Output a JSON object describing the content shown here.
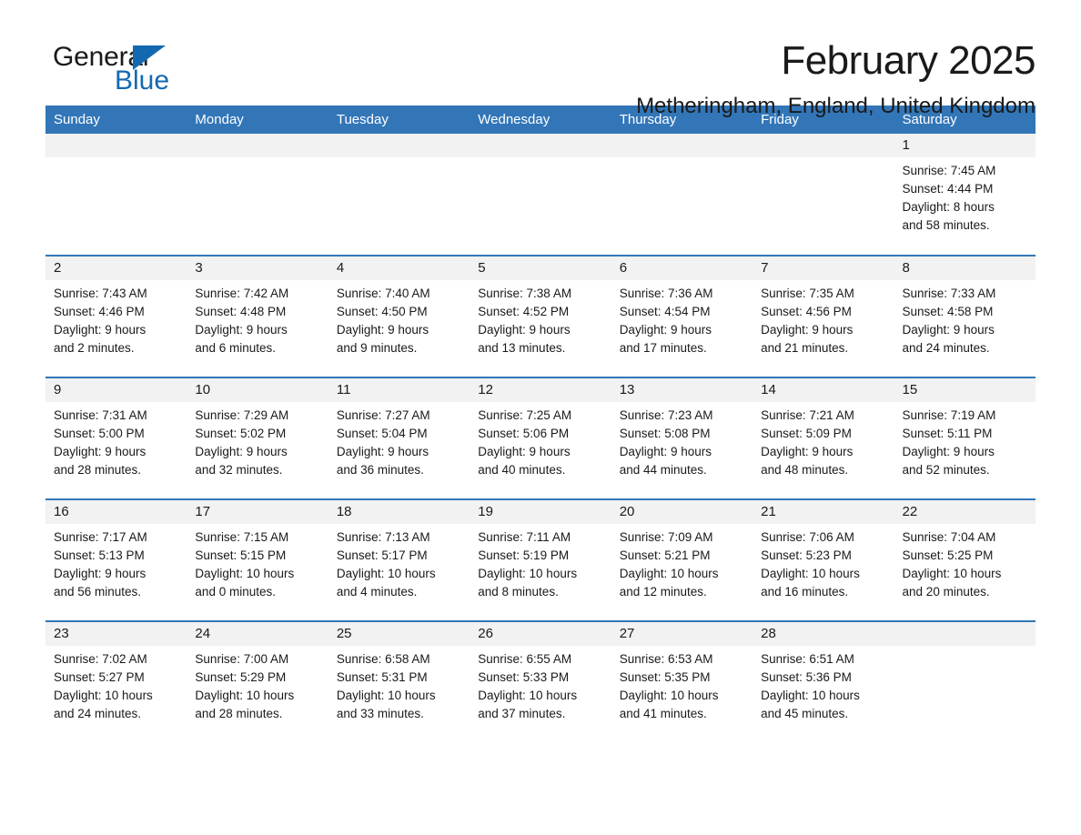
{
  "logo": {
    "word_one": "General",
    "word_two": "Blue",
    "triangle_color": "#1369b0",
    "icon": "triangle-icon"
  },
  "header": {
    "title": "February 2025",
    "subtitle": "Metheringham, England, United Kingdom"
  },
  "theme": {
    "header_blue": "#3276b8",
    "daynum_gray": "#f2f2f2",
    "text": "#1a1a1a",
    "logo_blue": "#1369b0"
  },
  "weekdays": [
    "Sunday",
    "Monday",
    "Tuesday",
    "Wednesday",
    "Thursday",
    "Friday",
    "Saturday"
  ],
  "labels": {
    "sunrise_prefix": "Sunrise:",
    "sunset_prefix": "Sunset:",
    "daylight_prefix": "Daylight:"
  },
  "weeks": [
    [
      {
        "day": "",
        "sunrise": "",
        "sunset": "",
        "daylight_l1": "",
        "daylight_l2": ""
      },
      {
        "day": "",
        "sunrise": "",
        "sunset": "",
        "daylight_l1": "",
        "daylight_l2": ""
      },
      {
        "day": "",
        "sunrise": "",
        "sunset": "",
        "daylight_l1": "",
        "daylight_l2": ""
      },
      {
        "day": "",
        "sunrise": "",
        "sunset": "",
        "daylight_l1": "",
        "daylight_l2": ""
      },
      {
        "day": "",
        "sunrise": "",
        "sunset": "",
        "daylight_l1": "",
        "daylight_l2": ""
      },
      {
        "day": "",
        "sunrise": "",
        "sunset": "",
        "daylight_l1": "",
        "daylight_l2": ""
      },
      {
        "day": "1",
        "sunrise": "Sunrise: 7:45 AM",
        "sunset": "Sunset: 4:44 PM",
        "daylight_l1": "Daylight: 8 hours",
        "daylight_l2": "and 58 minutes."
      }
    ],
    [
      {
        "day": "2",
        "sunrise": "Sunrise: 7:43 AM",
        "sunset": "Sunset: 4:46 PM",
        "daylight_l1": "Daylight: 9 hours",
        "daylight_l2": "and 2 minutes."
      },
      {
        "day": "3",
        "sunrise": "Sunrise: 7:42 AM",
        "sunset": "Sunset: 4:48 PM",
        "daylight_l1": "Daylight: 9 hours",
        "daylight_l2": "and 6 minutes."
      },
      {
        "day": "4",
        "sunrise": "Sunrise: 7:40 AM",
        "sunset": "Sunset: 4:50 PM",
        "daylight_l1": "Daylight: 9 hours",
        "daylight_l2": "and 9 minutes."
      },
      {
        "day": "5",
        "sunrise": "Sunrise: 7:38 AM",
        "sunset": "Sunset: 4:52 PM",
        "daylight_l1": "Daylight: 9 hours",
        "daylight_l2": "and 13 minutes."
      },
      {
        "day": "6",
        "sunrise": "Sunrise: 7:36 AM",
        "sunset": "Sunset: 4:54 PM",
        "daylight_l1": "Daylight: 9 hours",
        "daylight_l2": "and 17 minutes."
      },
      {
        "day": "7",
        "sunrise": "Sunrise: 7:35 AM",
        "sunset": "Sunset: 4:56 PM",
        "daylight_l1": "Daylight: 9 hours",
        "daylight_l2": "and 21 minutes."
      },
      {
        "day": "8",
        "sunrise": "Sunrise: 7:33 AM",
        "sunset": "Sunset: 4:58 PM",
        "daylight_l1": "Daylight: 9 hours",
        "daylight_l2": "and 24 minutes."
      }
    ],
    [
      {
        "day": "9",
        "sunrise": "Sunrise: 7:31 AM",
        "sunset": "Sunset: 5:00 PM",
        "daylight_l1": "Daylight: 9 hours",
        "daylight_l2": "and 28 minutes."
      },
      {
        "day": "10",
        "sunrise": "Sunrise: 7:29 AM",
        "sunset": "Sunset: 5:02 PM",
        "daylight_l1": "Daylight: 9 hours",
        "daylight_l2": "and 32 minutes."
      },
      {
        "day": "11",
        "sunrise": "Sunrise: 7:27 AM",
        "sunset": "Sunset: 5:04 PM",
        "daylight_l1": "Daylight: 9 hours",
        "daylight_l2": "and 36 minutes."
      },
      {
        "day": "12",
        "sunrise": "Sunrise: 7:25 AM",
        "sunset": "Sunset: 5:06 PM",
        "daylight_l1": "Daylight: 9 hours",
        "daylight_l2": "and 40 minutes."
      },
      {
        "day": "13",
        "sunrise": "Sunrise: 7:23 AM",
        "sunset": "Sunset: 5:08 PM",
        "daylight_l1": "Daylight: 9 hours",
        "daylight_l2": "and 44 minutes."
      },
      {
        "day": "14",
        "sunrise": "Sunrise: 7:21 AM",
        "sunset": "Sunset: 5:09 PM",
        "daylight_l1": "Daylight: 9 hours",
        "daylight_l2": "and 48 minutes."
      },
      {
        "day": "15",
        "sunrise": "Sunrise: 7:19 AM",
        "sunset": "Sunset: 5:11 PM",
        "daylight_l1": "Daylight: 9 hours",
        "daylight_l2": "and 52 minutes."
      }
    ],
    [
      {
        "day": "16",
        "sunrise": "Sunrise: 7:17 AM",
        "sunset": "Sunset: 5:13 PM",
        "daylight_l1": "Daylight: 9 hours",
        "daylight_l2": "and 56 minutes."
      },
      {
        "day": "17",
        "sunrise": "Sunrise: 7:15 AM",
        "sunset": "Sunset: 5:15 PM",
        "daylight_l1": "Daylight: 10 hours",
        "daylight_l2": "and 0 minutes."
      },
      {
        "day": "18",
        "sunrise": "Sunrise: 7:13 AM",
        "sunset": "Sunset: 5:17 PM",
        "daylight_l1": "Daylight: 10 hours",
        "daylight_l2": "and 4 minutes."
      },
      {
        "day": "19",
        "sunrise": "Sunrise: 7:11 AM",
        "sunset": "Sunset: 5:19 PM",
        "daylight_l1": "Daylight: 10 hours",
        "daylight_l2": "and 8 minutes."
      },
      {
        "day": "20",
        "sunrise": "Sunrise: 7:09 AM",
        "sunset": "Sunset: 5:21 PM",
        "daylight_l1": "Daylight: 10 hours",
        "daylight_l2": "and 12 minutes."
      },
      {
        "day": "21",
        "sunrise": "Sunrise: 7:06 AM",
        "sunset": "Sunset: 5:23 PM",
        "daylight_l1": "Daylight: 10 hours",
        "daylight_l2": "and 16 minutes."
      },
      {
        "day": "22",
        "sunrise": "Sunrise: 7:04 AM",
        "sunset": "Sunset: 5:25 PM",
        "daylight_l1": "Daylight: 10 hours",
        "daylight_l2": "and 20 minutes."
      }
    ],
    [
      {
        "day": "23",
        "sunrise": "Sunrise: 7:02 AM",
        "sunset": "Sunset: 5:27 PM",
        "daylight_l1": "Daylight: 10 hours",
        "daylight_l2": "and 24 minutes."
      },
      {
        "day": "24",
        "sunrise": "Sunrise: 7:00 AM",
        "sunset": "Sunset: 5:29 PM",
        "daylight_l1": "Daylight: 10 hours",
        "daylight_l2": "and 28 minutes."
      },
      {
        "day": "25",
        "sunrise": "Sunrise: 6:58 AM",
        "sunset": "Sunset: 5:31 PM",
        "daylight_l1": "Daylight: 10 hours",
        "daylight_l2": "and 33 minutes."
      },
      {
        "day": "26",
        "sunrise": "Sunrise: 6:55 AM",
        "sunset": "Sunset: 5:33 PM",
        "daylight_l1": "Daylight: 10 hours",
        "daylight_l2": "and 37 minutes."
      },
      {
        "day": "27",
        "sunrise": "Sunrise: 6:53 AM",
        "sunset": "Sunset: 5:35 PM",
        "daylight_l1": "Daylight: 10 hours",
        "daylight_l2": "and 41 minutes."
      },
      {
        "day": "28",
        "sunrise": "Sunrise: 6:51 AM",
        "sunset": "Sunset: 5:36 PM",
        "daylight_l1": "Daylight: 10 hours",
        "daylight_l2": "and 45 minutes."
      },
      {
        "day": "",
        "sunrise": "",
        "sunset": "",
        "daylight_l1": "",
        "daylight_l2": ""
      }
    ]
  ]
}
